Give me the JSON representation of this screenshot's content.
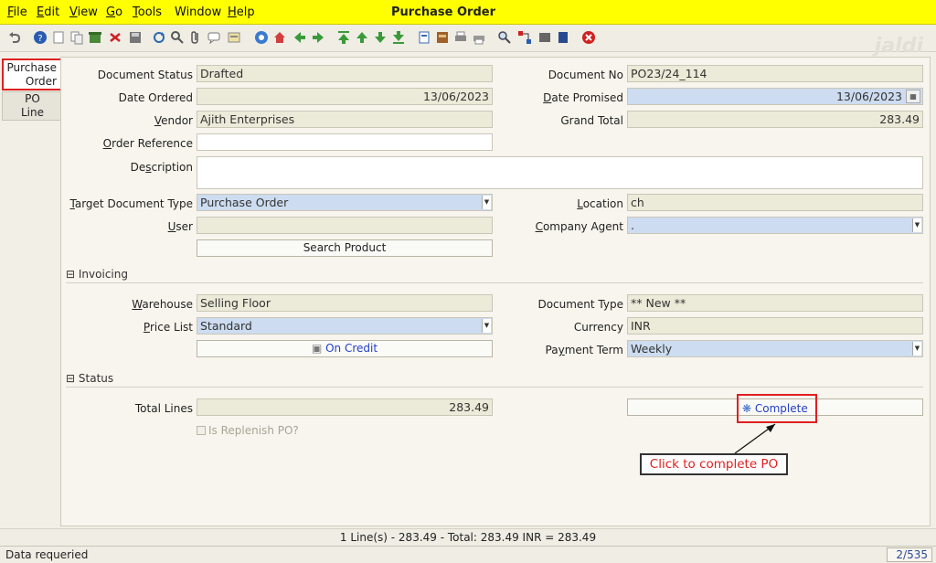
{
  "menubar": {
    "items": [
      {
        "first": "F",
        "rest": "ile"
      },
      {
        "first": "E",
        "rest": "dit"
      },
      {
        "first": "V",
        "rest": "iew"
      },
      {
        "first": "G",
        "rest": "o"
      },
      {
        "first": "T",
        "rest": "ools"
      },
      {
        "first": "",
        "rest": "Window"
      },
      {
        "first": "H",
        "rest": "elp"
      }
    ],
    "title": "Purchase Order"
  },
  "logo": "jaldi",
  "tabs": {
    "purchase_order_line1": "Purchase",
    "purchase_order_line2": "Order",
    "po_line_line1": "PO",
    "po_line_line2": "Line"
  },
  "form": {
    "document_status": {
      "label": "Document Status",
      "value": "Drafted"
    },
    "document_no": {
      "label": "Document No",
      "value": "PO23/24_114"
    },
    "date_ordered": {
      "label": "Date Ordered",
      "value": "13/06/2023"
    },
    "date_promised": {
      "label_first": "D",
      "label_rest": "ate Promised",
      "value": "13/06/2023"
    },
    "vendor": {
      "label_first": "V",
      "label_rest": "endor",
      "value": "Ajith Enterprises"
    },
    "grand_total": {
      "label": "Grand Total",
      "value": "283.49"
    },
    "order_reference": {
      "label_first": "O",
      "label_rest": "rder Reference",
      "value": ""
    },
    "description": {
      "label_pre": "De",
      "label_first": "s",
      "label_rest": "cription",
      "value": ""
    },
    "target_doc_type": {
      "label_first": "T",
      "label_rest": "arget Document Type",
      "value": "Purchase Order"
    },
    "location": {
      "label_first": "L",
      "label_rest": "ocation",
      "value": "ch"
    },
    "user": {
      "label_pre": "",
      "label_first": "U",
      "label_rest": "ser",
      "value": ""
    },
    "company_agent": {
      "label_first": "C",
      "label_rest": "ompany Agent",
      "value": "."
    },
    "search_product_btn": "Search Product"
  },
  "invoicing": {
    "section_label": "Invoicing",
    "warehouse": {
      "label_first": "W",
      "label_rest": "arehouse",
      "value": "Selling Floor"
    },
    "document_type": {
      "label": "Document Type",
      "value": "** New **"
    },
    "price_list": {
      "label_first": "P",
      "label_rest": "rice List",
      "value": "Standard"
    },
    "currency": {
      "label": "Currency",
      "value": "INR"
    },
    "on_credit_btn": "On Credit",
    "payment_term": {
      "label_pre": "Pa",
      "label_first": "y",
      "label_rest": "ment Term",
      "value": "Weekly"
    }
  },
  "status": {
    "section_label": "Status",
    "total_lines": {
      "label": "Total Lines",
      "value": "283.49"
    },
    "complete_btn": "Complete",
    "is_replenish": {
      "label": "Is Replenish PO?",
      "checked": false
    }
  },
  "callout": "Click to complete PO",
  "summary_line": "1 Line(s) - 283.49 -  Total: 283.49  INR  =  283.49",
  "statusbar": {
    "message": "Data requeried",
    "record": "2/535"
  },
  "colors": {
    "menubar": "#ffff00",
    "highlight": "#e02020",
    "link": "#2440c8",
    "selected_field": "#cddcf0"
  }
}
